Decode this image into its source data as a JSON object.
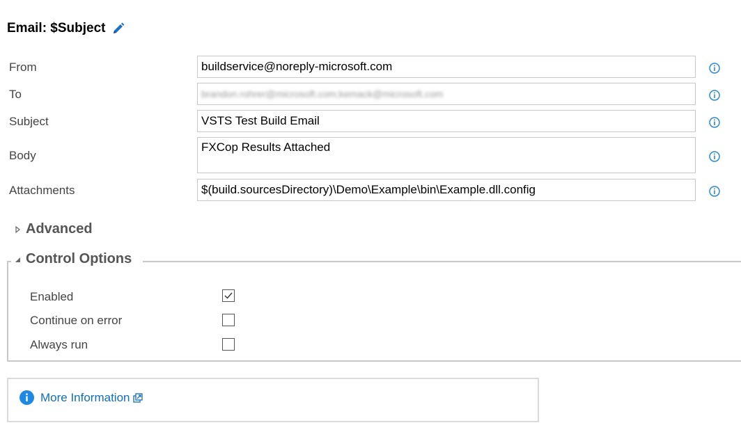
{
  "header": {
    "title": "Email: $Subject",
    "edit_icon": "pencil-icon"
  },
  "form": {
    "from": {
      "label": "From",
      "value": "buildservice@noreply-microsoft.com"
    },
    "to": {
      "label": "To",
      "value": "brandon.rohrer@microsoft.com;kemack@microsoft.com"
    },
    "subject": {
      "label": "Subject",
      "value": "VSTS Test Build Email"
    },
    "body": {
      "label": "Body",
      "value": "FXCop Results Attached"
    },
    "attachments": {
      "label": "Attachments",
      "value": "$(build.sourcesDirectory)\\Demo\\Example\\bin\\Example.dll.config"
    }
  },
  "sections": {
    "advanced": {
      "label": "Advanced",
      "expanded": false
    },
    "control_options": {
      "label": "Control Options",
      "expanded": true
    }
  },
  "control_options": {
    "enabled": {
      "label": "Enabled",
      "checked": true
    },
    "continue_on_error": {
      "label": "Continue on error",
      "checked": false
    },
    "always_run": {
      "label": "Always run",
      "checked": false
    }
  },
  "more_info": {
    "label": "More Information"
  },
  "colors": {
    "accent": "#106ebe",
    "info_icon": "#2b88d8",
    "border": "#c8c8c8"
  }
}
